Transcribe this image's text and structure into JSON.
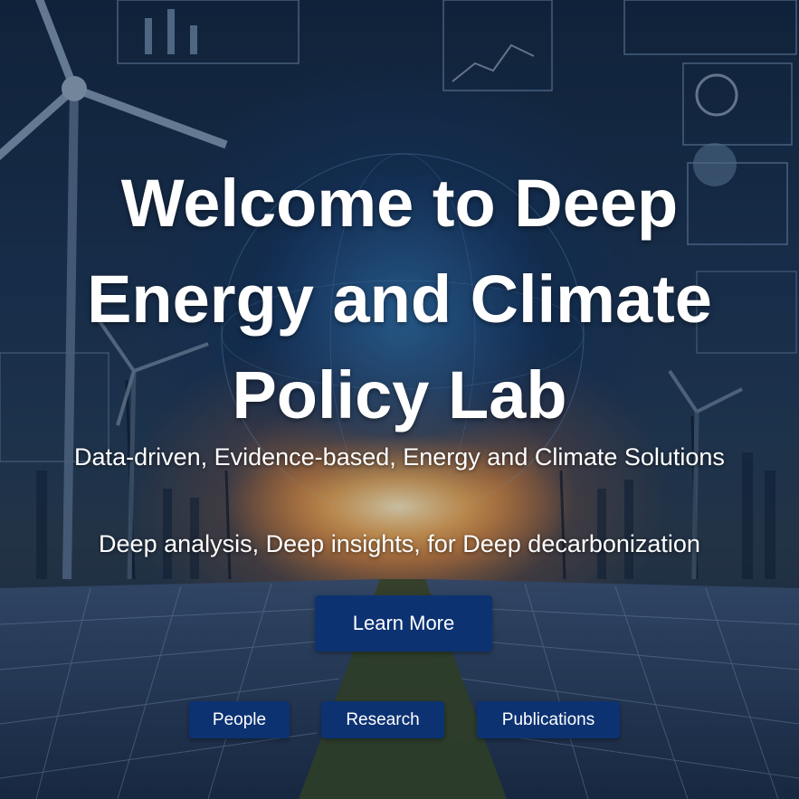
{
  "hero": {
    "title_lines": [
      "Welcome to Deep",
      "Energy and Climate",
      "Policy Lab"
    ],
    "subtitle": "Data-driven, Evidence-based, Energy and Climate Solutions",
    "tagline": "Deep analysis, Deep insights, for Deep decarbonization",
    "cta_label": "Learn More"
  },
  "nav": {
    "items": [
      {
        "label": "People"
      },
      {
        "label": "Research"
      },
      {
        "label": "Publications"
      }
    ]
  },
  "colors": {
    "button_bg": "#0c3272",
    "text": "#ffffff",
    "sky_dark": "#13263f",
    "sun_glow": "#f0a050"
  },
  "background": {
    "description_icons": [
      "wind-turbine-icon",
      "globe-icon",
      "solar-panel-icon",
      "bar-chart-icon"
    ]
  }
}
